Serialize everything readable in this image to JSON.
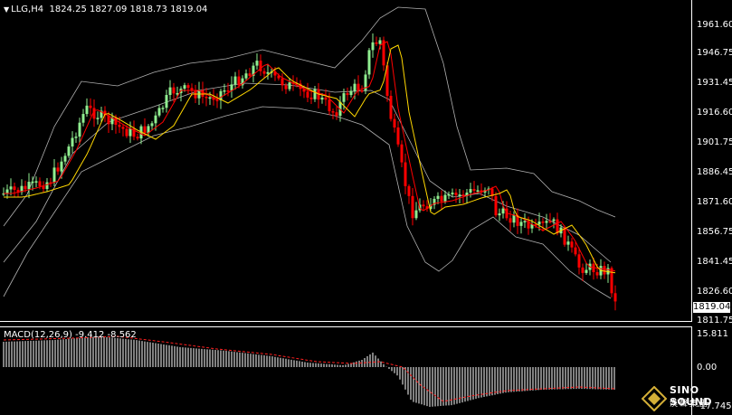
{
  "header": {
    "symbol_timeframe": "LLG,H4",
    "ohlc": "1824.25 1827.09 1818.73 1819.04"
  },
  "price_axis": {
    "labels": [
      "1961.60",
      "1946.75",
      "1931.45",
      "1916.60",
      "1901.75",
      "1886.45",
      "1871.60",
      "1856.75",
      "1841.45",
      "1826.60",
      "1811.75"
    ],
    "current_price": "1819.04"
  },
  "macd": {
    "label": "MACD(12,26,9) -9.412 -8.562",
    "axis_labels": [
      "15.811",
      "0.00",
      "-17.745"
    ]
  },
  "logo": {
    "line1": "SINO SOUND",
    "line2": "漢聲集團"
  },
  "colors": {
    "background": "#000000",
    "bull_candle": "#90ee90",
    "bear_candle": "#ff0000",
    "ma_fast": "#ff0000",
    "ma_slow": "#ffd700",
    "bollinger": "#b0b0b0",
    "macd_hist": "#ffffff",
    "macd_signal": "#ff2020"
  }
}
